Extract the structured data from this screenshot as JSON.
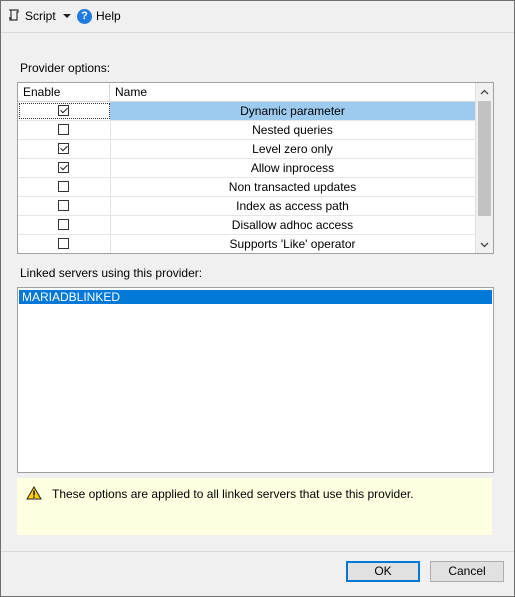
{
  "toolbar": {
    "script_label": "Script",
    "help_label": "Help",
    "help_glyph": "?"
  },
  "provider_options": {
    "label": "Provider options:",
    "columns": {
      "enable": "Enable",
      "name": "Name"
    },
    "rows": [
      {
        "name": "Dynamic parameter",
        "checked": true,
        "selected": true
      },
      {
        "name": "Nested queries",
        "checked": false,
        "selected": false
      },
      {
        "name": "Level zero only",
        "checked": true,
        "selected": false
      },
      {
        "name": "Allow inprocess",
        "checked": true,
        "selected": false
      },
      {
        "name": "Non transacted updates",
        "checked": false,
        "selected": false
      },
      {
        "name": "Index as access path",
        "checked": false,
        "selected": false
      },
      {
        "name": "Disallow adhoc access",
        "checked": false,
        "selected": false
      },
      {
        "name": "Supports 'Like' operator",
        "checked": false,
        "selected": false
      }
    ]
  },
  "linked_servers": {
    "label": "Linked servers using this provider:",
    "items": [
      "MARIADBLINKED"
    ]
  },
  "info": {
    "text": "These options are applied to all linked servers that use this provider.",
    "icon": "warning-icon"
  },
  "buttons": {
    "ok": "OK",
    "cancel": "Cancel"
  },
  "colors": {
    "selected_row": "#9ccbef",
    "list_selection": "#0078d7",
    "info_background": "#ffffe1",
    "accent": "#0078d7"
  }
}
